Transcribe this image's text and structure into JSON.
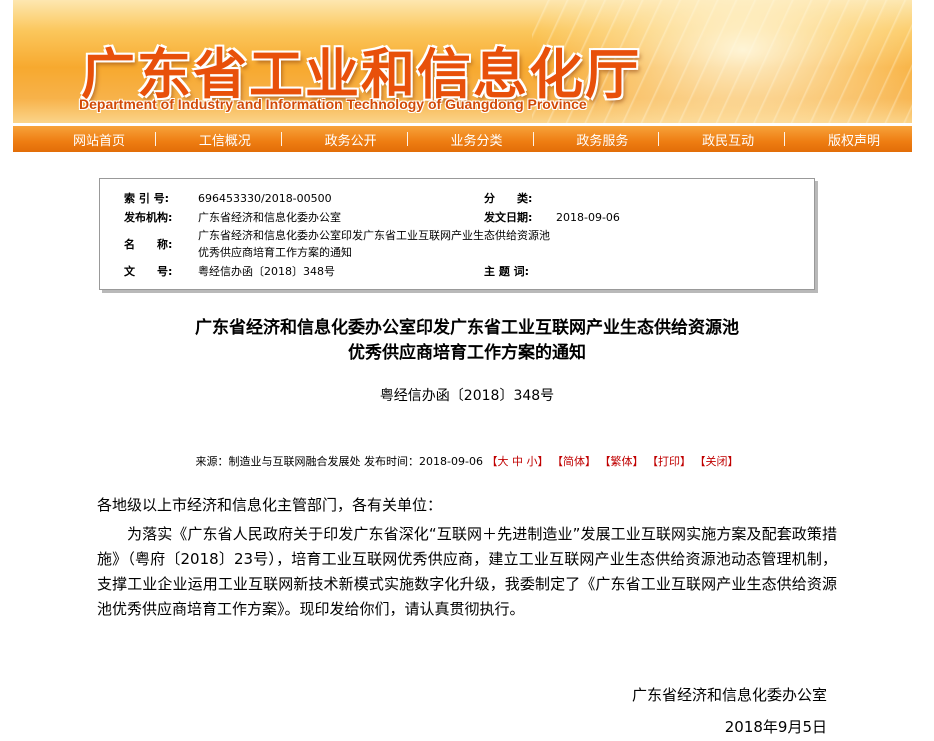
{
  "banner": {
    "title": "广东省工业和信息化厅",
    "subtitle": "Department of Industry and Information Technology of Guangdong Province"
  },
  "nav": [
    {
      "label": "网站首页"
    },
    {
      "label": "工信概况"
    },
    {
      "label": "政务公开"
    },
    {
      "label": "业务分类"
    },
    {
      "label": "政务服务"
    },
    {
      "label": "政民互动"
    },
    {
      "label": "版权声明"
    }
  ],
  "info": {
    "index_label": "索 引 号:",
    "index_value": "696453330/2018-00500",
    "category_label": "分　　类:",
    "category_value": "",
    "issuer_label": "发布机构:",
    "issuer_value": "广东省经济和信息化委办公室",
    "date_label": "发文日期:",
    "date_value": "2018-09-06",
    "name_label": "名　　称:",
    "name_value_1": "广东省经济和信息化委办公室印发广东省工业互联网产业生态供给资源池",
    "name_value_2": "优秀供应商培育工作方案的通知",
    "docno_label": "文　　号:",
    "docno_value": "粤经信办函〔2018〕348号",
    "topic_label": "主 题 词:",
    "topic_value": ""
  },
  "article": {
    "title_1": "广东省经济和信息化委办公室印发广东省工业互联网产业生态供给资源池",
    "title_2": "优秀供应商培育工作方案的通知",
    "doc_no": "粤经信办函〔2018〕348号",
    "meta": {
      "source": "来源：制造业与互联网融合发展处 发布时间：2018-09-06",
      "font_open": "【",
      "font_large": "大",
      "font_medium": "中",
      "font_small": "小",
      "font_close": "】",
      "simplified": "【简体】",
      "traditional": "【繁体】",
      "print": "【打印】",
      "close": "【关闭】"
    },
    "salutation": "各地级以上市经济和信息化主管部门，各有关单位：",
    "paragraph": "为落实《广东省人民政府关于印发广东省深化“互联网＋先进制造业”发展工业互联网实施方案及配套政策措施》（粤府〔2018〕23号），培育工业互联网优秀供应商，建立工业互联网产业生态供给资源池动态管理机制，支撑工业企业运用工业互联网新技术新模式实施数字化升级，我委制定了《广东省工业互联网产业生态供给资源池优秀供应商培育工作方案》。现印发给你们，请认真贯彻执行。",
    "sign_org": "广东省经济和信息化委办公室",
    "sign_date": "2018年9月5日"
  },
  "colors": {
    "banner_text": "#e8500a",
    "nav_bg": "#ee7d12",
    "highlight": "#c00000"
  }
}
